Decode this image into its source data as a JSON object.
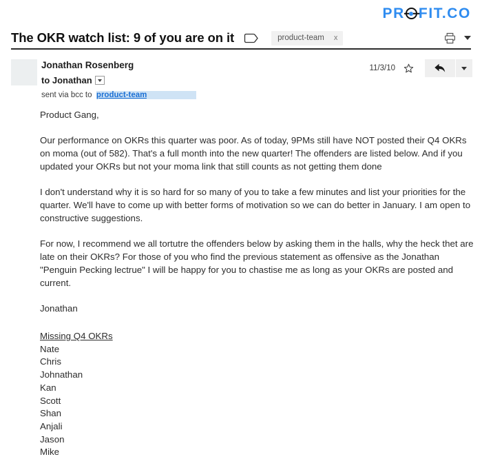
{
  "brand": {
    "name": "PROFIT.CO",
    "part_one": "PR",
    "part_two": "FIT.CO",
    "target_icon": "target-crosshair-icon",
    "color": "#2f8cf0",
    "accent_dark": "#111111"
  },
  "toolbar": {
    "thread_title": "The OKR watch list: 9 of you are on it",
    "label_icon": "label-tag-icon",
    "label_chip": {
      "text": "product-team",
      "remove": "x"
    },
    "print_icon": "printer-icon",
    "more_icon": "chevron-down-icon"
  },
  "message": {
    "avatar": "avatar-placeholder",
    "sender": "Jonathan Rosenberg",
    "recipient": "to Jonathan",
    "recipient_caret_icon": "chevron-down-icon",
    "bcc_prefix": "sent via bcc to",
    "bcc_recipient": "product-team",
    "date": "11/3/10",
    "star_icon": "star-outline-icon",
    "reply_icon": "reply-arrow-icon",
    "reply_more_icon": "chevron-down-icon",
    "highlight_color": "#cfe3f5",
    "link_color": "#1a6fd4"
  },
  "body": {
    "greeting": "Product Gang,",
    "paragraph_1": "Our performance on OKRs this quarter was poor. As of today, 9PMs still have NOT posted their Q4 OKRs on moma (out of 582). That's a full month into the new quarter! The offenders are listed below. And if you updated your OKRs but not your moma link that still counts as not getting them done",
    "paragraph_2": "I don't understand why it is so hard for so many of you to take a few minutes and list your priorities for the quarter. We'll have to come up with better forms of motivation so we can do better in January. I am open to constructive suggestions.",
    "paragraph_3": "For now, I recommend we all tortutre the offenders below by asking them in the halls, why the heck thet are late on their OKRs? For those of you who find the previous statement as offensive as the Jonathan \"Penguin Pecking lectrue\" I will be happy for you to chastise me as long as your OKRs are posted and current.",
    "signature": "Jonathan",
    "list_heading": "Missing Q4 OKRs",
    "names": [
      "Nate",
      "Chris",
      "Johnathan",
      "Kan",
      "Scott",
      "Shan",
      "Anjali",
      "Jason",
      "Mike"
    ]
  }
}
